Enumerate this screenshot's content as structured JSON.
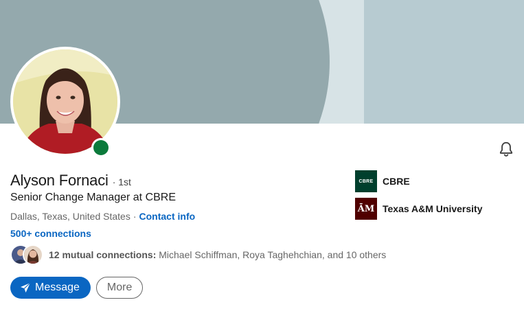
{
  "profile": {
    "name": "Alyson Fornaci",
    "degree": "· 1st",
    "headline": "Senior Change Manager at CBRE",
    "location": "Dallas, Texas, United States",
    "location_separator": "·",
    "contact_label": "Contact info",
    "connections": "500+ connections",
    "online": true
  },
  "mutual": {
    "count_label": "12 mutual connections:",
    "names": "Michael Schiffman, Roya Taghehchian, and 10 others"
  },
  "actions": {
    "message_label": "Message",
    "more_label": "More"
  },
  "companies": [
    {
      "label": "CBRE",
      "logo_text": "CBRE",
      "logo_color": "#003f2d"
    },
    {
      "label": "Texas A&M University",
      "logo_text": "ĀM",
      "logo_color": "#500000"
    }
  ],
  "icons": {
    "notification": "bell-icon",
    "message": "paper-plane-icon"
  },
  "colors": {
    "accent": "#0a66c2",
    "online": "#0b7a3b",
    "cover": "#94a9ad"
  }
}
